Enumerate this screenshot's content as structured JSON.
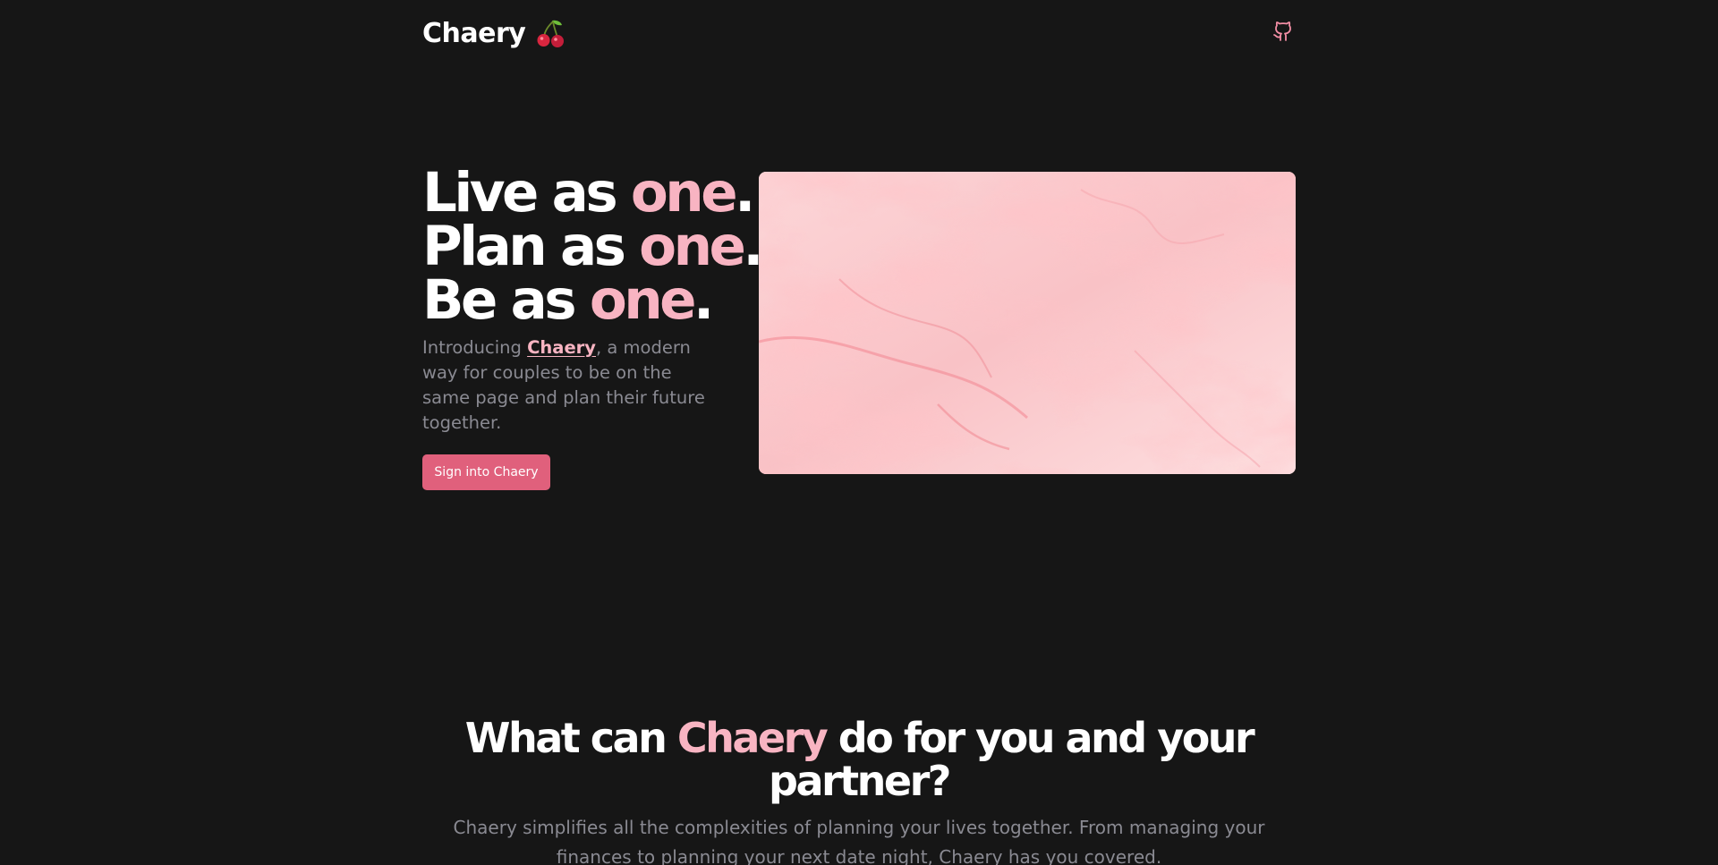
{
  "header": {
    "brand_name": "Chaery",
    "brand_icon": "cherry-icon",
    "github_icon": "github-icon"
  },
  "hero": {
    "line1_prefix": "Live as ",
    "line2_prefix": "Plan as ",
    "line3_prefix": "Be as ",
    "accent_word": "one",
    "line_suffix": ".",
    "desc_before": "Introducing ",
    "desc_link": "Chaery",
    "desc_after": ", a modern way for couples to be on the same page and plan their future together.",
    "cta_label": "Sign into Chaery"
  },
  "features": {
    "title_before": "What can ",
    "title_accent": "Chaery",
    "title_after": " do for you and your",
    "title_line2": "partner?",
    "subtitle": "Chaery simplifies all the complexities of planning your lives together. From managing your finances to planning your next date night, Chaery has you covered."
  },
  "colors": {
    "background": "#161616",
    "accent": "#f8b4c2",
    "button": "#e0607c",
    "muted_text": "#8a8a92"
  }
}
